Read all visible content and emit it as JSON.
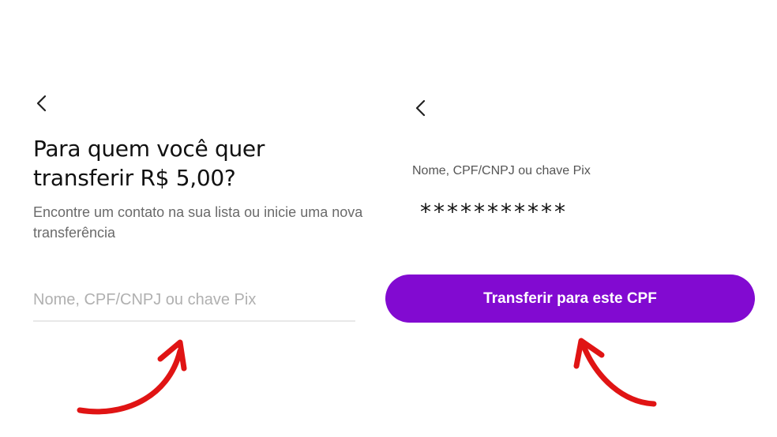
{
  "left_screen": {
    "title": "Para quem você quer transferir R$ 5,00?",
    "subtitle": "Encontre um contato na sua lista ou inicie uma nova transferência",
    "recipient_input": {
      "placeholder": "Nome, CPF/CNPJ ou chave Pix",
      "value": ""
    },
    "back_icon": "chevron-left-icon"
  },
  "right_screen": {
    "field_label": "Nome, CPF/CNPJ ou chave Pix",
    "field_value": "***********",
    "transfer_button_label": "Transferir para este CPF",
    "back_icon": "chevron-left-icon"
  },
  "colors": {
    "accent_purple": "#820ad1",
    "annotation_red": "#e01414",
    "title_text": "#111111",
    "secondary_text": "#6a6a6a",
    "placeholder_text": "#b0b0b0"
  }
}
